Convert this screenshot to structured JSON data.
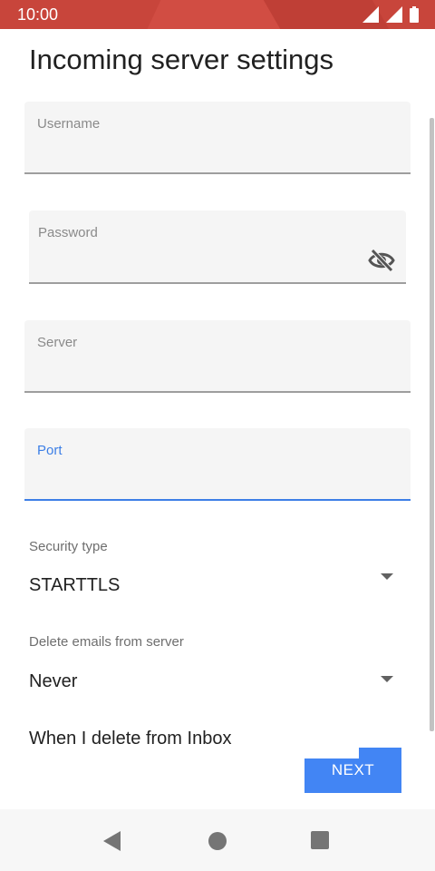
{
  "status_bar": {
    "time": "10:00",
    "background": "#c8453b"
  },
  "page": {
    "title": "Incoming server settings"
  },
  "fields": {
    "username": {
      "label": "Username",
      "value": ""
    },
    "password": {
      "label": "Password",
      "value": "",
      "toggle_icon": "eye-off-icon"
    },
    "server": {
      "label": "Server",
      "value": ""
    },
    "port": {
      "label": "Port",
      "value": "",
      "focused": true
    }
  },
  "security_type": {
    "label": "Security type",
    "value": "STARTTLS"
  },
  "delete_emails": {
    "label": "Delete emails from server",
    "value": "Never"
  },
  "inbox_delete_text": "When I delete from Inbox",
  "next_button": {
    "label": "NEXT",
    "color": "#4285f4"
  },
  "accent_color": "#3d7fe6"
}
